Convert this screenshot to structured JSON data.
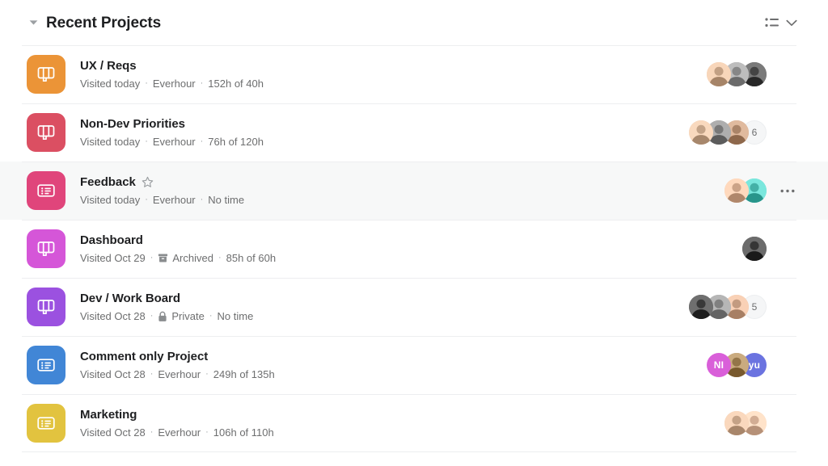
{
  "header": {
    "title": "Recent Projects",
    "disclosure_icon": "triangle-down-icon",
    "view_icon": "list-view-icon",
    "chevron_icon": "chevron-down-icon"
  },
  "colors": {
    "background": "#ffffff",
    "row_hover": "#f7f8f8",
    "divider": "#edeef0",
    "text_primary": "#1e1f21",
    "text_secondary": "#6d6e6f"
  },
  "projects": [
    {
      "name": "UX / Reqs",
      "icon_type": "board-icon",
      "icon_color": "#eb9437",
      "favorited": false,
      "visited": "Visited today",
      "integration": "Everhour",
      "integration_icon": "",
      "time": "152h of 40h",
      "members": [
        {
          "type": "photo",
          "tone": "#c8a68a"
        },
        {
          "type": "photo",
          "tone": "#8d8d8d"
        },
        {
          "type": "photo",
          "tone": "#4a4a4a"
        }
      ],
      "overflow_count": "",
      "hovered": false
    },
    {
      "name": "Non-Dev Priorities",
      "icon_type": "board-icon",
      "icon_color": "#db4f62",
      "favorited": false,
      "visited": "Visited today",
      "integration": "Everhour",
      "integration_icon": "",
      "time": "76h of 120h",
      "members": [
        {
          "type": "photo",
          "tone": "#c9a98e"
        },
        {
          "type": "photo",
          "tone": "#7e7e7e"
        },
        {
          "type": "photo",
          "tone": "#b08a6e"
        }
      ],
      "overflow_count": "6",
      "hovered": false
    },
    {
      "name": "Feedback",
      "icon_type": "list-icon",
      "icon_color": "#e0457b",
      "favorited": true,
      "visited": "Visited today",
      "integration": "Everhour",
      "integration_icon": "",
      "time": "No time",
      "members": [
        {
          "type": "photo",
          "tone": "#d2a98d"
        },
        {
          "type": "photo",
          "tone": "#4ab7ad"
        }
      ],
      "overflow_count": "",
      "hovered": true
    },
    {
      "name": "Dashboard",
      "icon_type": "board-icon",
      "icon_color": "#d556d8",
      "favorited": false,
      "visited": "Visited Oct 29",
      "integration": "Archived",
      "integration_icon": "archive-icon",
      "time": "85h of 60h",
      "members": [
        {
          "type": "photo",
          "tone": "#3c3c3c"
        }
      ],
      "overflow_count": "",
      "hovered": false
    },
    {
      "name": "Dev / Work Board",
      "icon_type": "board-icon",
      "icon_color": "#9b51e0",
      "favorited": false,
      "visited": "Visited Oct 28",
      "integration": "Private",
      "integration_icon": "lock-icon",
      "time": "No time",
      "members": [
        {
          "type": "photo",
          "tone": "#3f3f3f"
        },
        {
          "type": "photo",
          "tone": "#868686"
        },
        {
          "type": "photo",
          "tone": "#c9a186"
        }
      ],
      "overflow_count": "5",
      "hovered": false
    },
    {
      "name": "Comment only Project",
      "icon_type": "list-icon",
      "icon_color": "#4186d6",
      "favorited": false,
      "visited": "Visited Oct 28",
      "integration": "Everhour",
      "integration_icon": "",
      "time": "249h of 135h",
      "members": [
        {
          "type": "initials",
          "label": "NI",
          "tone": "#d95fd9"
        },
        {
          "type": "photo",
          "tone": "#9a7b4f"
        },
        {
          "type": "initials",
          "label": "yu",
          "tone": "#6b73e0"
        }
      ],
      "overflow_count": "",
      "hovered": false
    },
    {
      "name": "Marketing",
      "icon_type": "list-icon",
      "icon_color": "#e2c33f",
      "favorited": false,
      "visited": "Visited Oct 28",
      "integration": "Everhour",
      "integration_icon": "",
      "time": "106h of 110h",
      "members": [
        {
          "type": "photo",
          "tone": "#caa88d"
        },
        {
          "type": "photo",
          "tone": "#d8b39a"
        }
      ],
      "overflow_count": "",
      "hovered": false
    }
  ],
  "row_menu_icon": "more-horizontal-icon"
}
